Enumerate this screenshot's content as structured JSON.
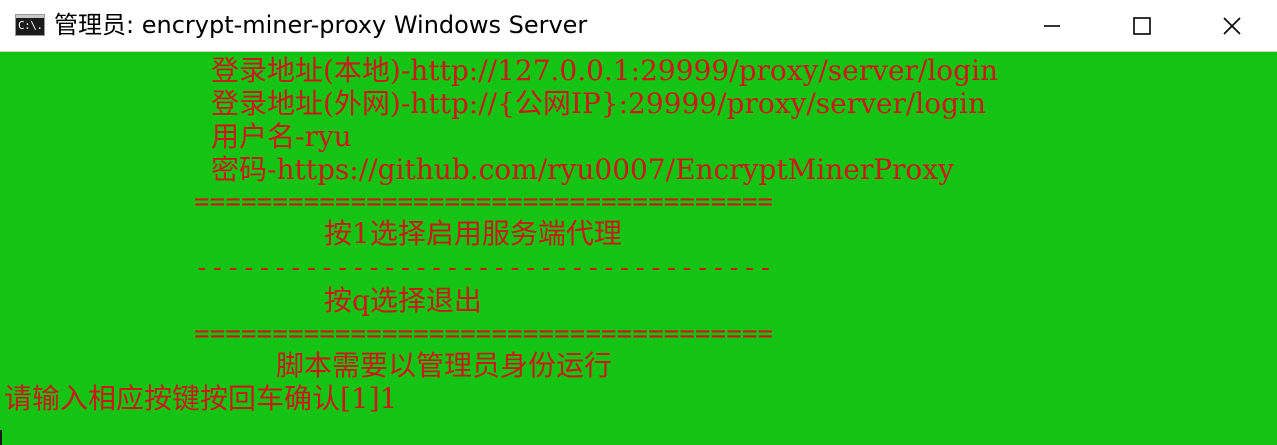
{
  "window": {
    "icon_text": "C:\\.",
    "title": "管理员:  encrypt-miner-proxy Windows Server"
  },
  "controls": {
    "minimize_icon": "minimize-icon",
    "maximize_icon": "maximize-icon",
    "close_icon": "close-icon"
  },
  "colors": {
    "console_bg": "#14c414",
    "console_text": "#cc1818",
    "titlebar_bg": "#ffffff"
  },
  "console": {
    "lines": [
      "登录地址(本地)-http://127.0.0.1:29999/proxy/server/login",
      "登录地址(外网)-http://{公网IP}:29999/proxy/server/login",
      "用户名-ryu",
      "密码-https://github.com/ryu0007/EncryptMinerProxy",
      "=====================================",
      "按1选择启用服务端代理",
      "-------------------------------------",
      "按q选择退出",
      "=====================================",
      "脚本需要以管理员身份运行",
      "请输入相应按键按回车确认[1]1"
    ]
  }
}
